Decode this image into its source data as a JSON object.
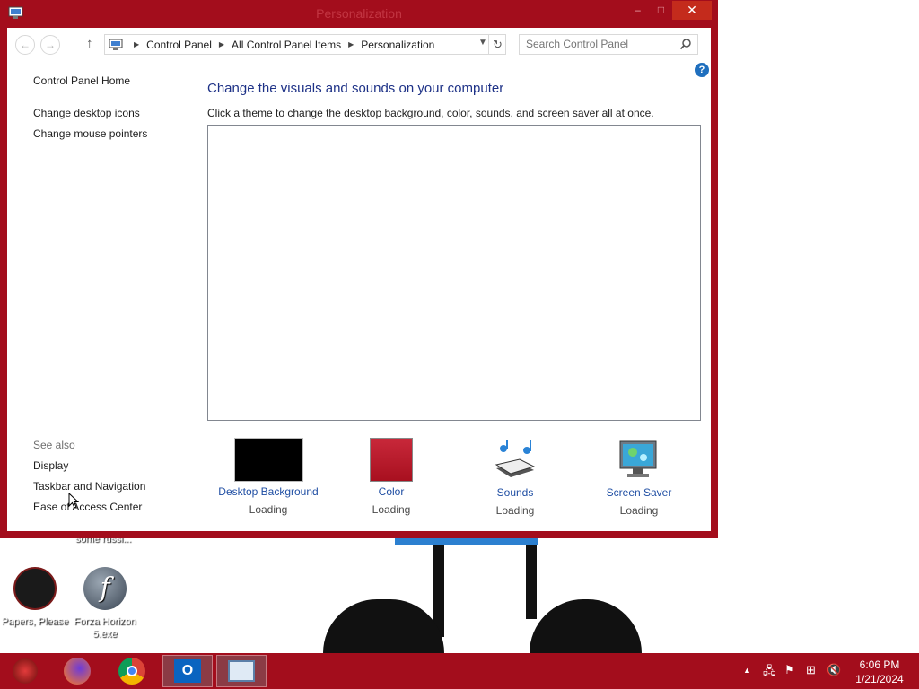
{
  "window": {
    "title": "Personalization",
    "minimize": "–",
    "maximize": "□",
    "close": "✕"
  },
  "address": {
    "crumbs": [
      "Control Panel",
      "All Control Panel Items",
      "Personalization"
    ],
    "search_placeholder": "Search Control Panel"
  },
  "left": {
    "home": "Control Panel Home",
    "links": [
      "Change desktop icons",
      "Change mouse pointers"
    ],
    "see_also_title": "See also",
    "see_also": [
      "Display",
      "Taskbar and Navigation",
      "Ease of Access Center"
    ]
  },
  "main": {
    "heading": "Change the visuals and sounds on your computer",
    "subtext": "Click a theme to change the desktop background, color, sounds, and screen saver all at once.",
    "tiles": [
      {
        "label": "Desktop Background",
        "status": "Loading",
        "icon": "desktop-background-icon"
      },
      {
        "label": "Color",
        "status": "Loading",
        "icon": "color-swatch-icon"
      },
      {
        "label": "Sounds",
        "status": "Loading",
        "icon": "sounds-icon"
      },
      {
        "label": "Screen Saver",
        "status": "Loading",
        "icon": "screen-saver-icon"
      }
    ]
  },
  "desktop": {
    "partial_label": "some russi...",
    "icons": [
      {
        "label": "Papers, Please",
        "icon": "papers-please-icon"
      },
      {
        "label": "Forza Horizon 5.exe",
        "icon": "flash-icon"
      }
    ]
  },
  "taskbar": {
    "time": "6:06 PM",
    "date": "1/21/2024"
  },
  "colors": {
    "accent": "#a30d1c",
    "link": "#1f4ea3",
    "heading": "#1e3287"
  }
}
